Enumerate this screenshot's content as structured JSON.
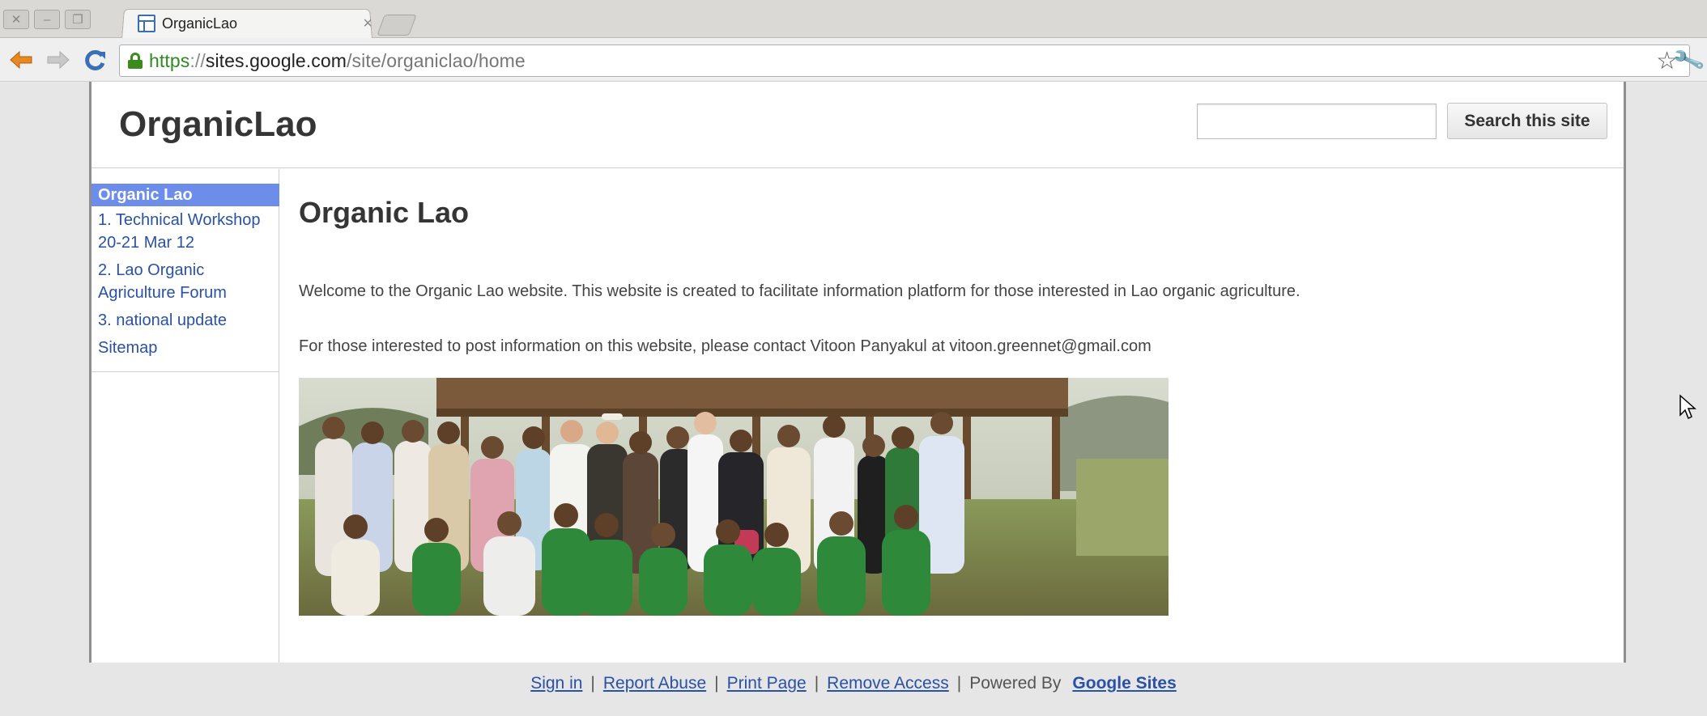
{
  "browser": {
    "tab_title": "OrganicLao",
    "tab_close": "×",
    "url_scheme": "https",
    "url_sep": "://",
    "url_host": "sites.google.com",
    "url_path": "/site/organiclao/home",
    "icons": [
      "back-icon",
      "forward-icon",
      "reload-icon",
      "lock-icon",
      "star-icon",
      "wrench-icon"
    ]
  },
  "header": {
    "site_title": "OrganicLao",
    "search_value": "",
    "search_button": "Search this site"
  },
  "sidebar": {
    "items": [
      {
        "label": "Organic Lao"
      },
      {
        "label": "1. Technical Workshop 20-21 Mar 12"
      },
      {
        "label": "2. Lao Organic Agriculture Forum"
      },
      {
        "label": "3. national update"
      },
      {
        "label": "Sitemap"
      }
    ]
  },
  "main": {
    "title": "Organic Lao",
    "paragraph1": "Welcome to the Organic Lao website. This website is created to facilitate information platform for those interested in Lao organic agriculture.",
    "paragraph2": "For those interested to post information on this website, please contact Vitoon Panyakul at vitoon.greennet@gmail.com"
  },
  "footer": {
    "sign_in": "Sign in",
    "report_abuse": "Report Abuse",
    "print_page": "Print Page",
    "remove_access": "Remove Access",
    "powered_by": "Powered By",
    "google_sites": "Google Sites",
    "separator": "|"
  },
  "colors": {
    "accent": "#6c8de9",
    "link": "#2951a8",
    "url_green": "#2e8b1f"
  }
}
